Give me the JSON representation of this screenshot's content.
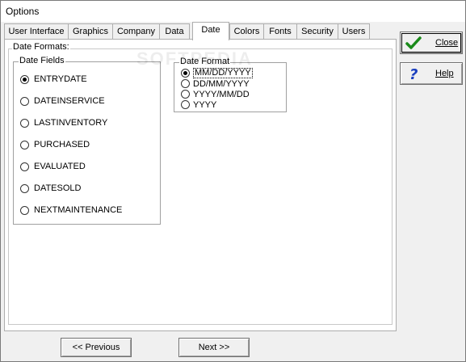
{
  "window": {
    "title": "Options"
  },
  "tabs": [
    {
      "label": "User Interface",
      "active": false
    },
    {
      "label": "Graphics",
      "active": false
    },
    {
      "label": "Company",
      "active": false
    },
    {
      "label": "Data",
      "active": false
    },
    {
      "label": "Date",
      "active": true
    },
    {
      "label": "Colors",
      "active": false
    },
    {
      "label": "Fonts",
      "active": false
    },
    {
      "label": "Security",
      "active": false
    },
    {
      "label": "Users",
      "active": false
    }
  ],
  "date_formats": {
    "title": "Date Formats:",
    "fields_group": {
      "label": "Date Fields",
      "selected": "ENTRYDATE",
      "items": [
        "ENTRYDATE",
        "DATEINSERVICE",
        "LASTINVENTORY",
        "PURCHASED",
        "EVALUATED",
        "DATESOLD",
        "NEXTMAINTENANCE"
      ]
    },
    "format_group": {
      "label": "Date Format",
      "selected": "MM/DD/YYYY",
      "items": [
        "MM/DD/YYYY",
        "DD/MM/YYYY",
        "YYYY/MM/DD",
        "YYYY"
      ]
    }
  },
  "side_buttons": {
    "close": {
      "label": "Close",
      "icon": "checkmark-icon",
      "color": "#1a8a1a"
    },
    "help": {
      "label": "Help",
      "icon": "question-mark-icon",
      "color": "#1a3fbf"
    }
  },
  "nav": {
    "previous_label": "<< Previous",
    "next_label": "Next >>"
  },
  "watermark": "SOFTPEDIA"
}
